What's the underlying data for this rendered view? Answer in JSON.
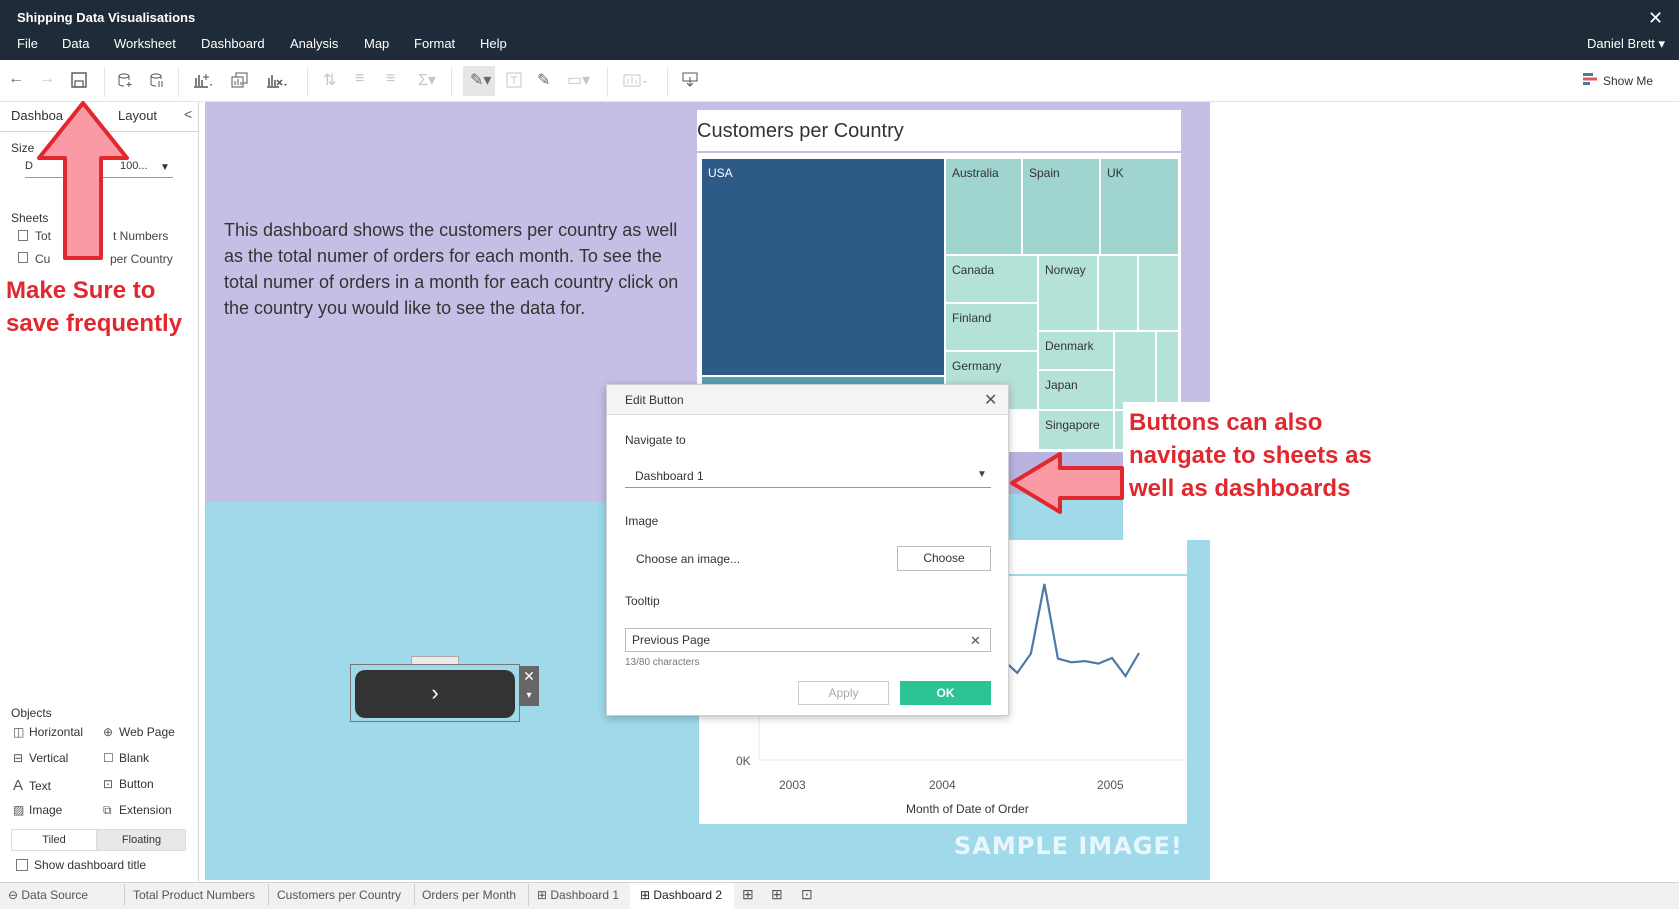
{
  "window": {
    "title": "Shipping Data Visualisations",
    "close_glyph": "✕"
  },
  "menu": {
    "items": [
      "File",
      "Data",
      "Worksheet",
      "Dashboard",
      "Analysis",
      "Map",
      "Format",
      "Help"
    ],
    "user": "Daniel Brett ▾"
  },
  "toolbar": {
    "show_me": "Show Me"
  },
  "left_pane": {
    "tab_dashboard": "Dashboa",
    "tab_layout": "Layout",
    "collapse": "<",
    "size_heading": "Size",
    "size_value_left": "D",
    "size_value_right": "100...",
    "size_caret": "▼",
    "sheets_heading": "Sheets",
    "sheet_1_left": "Tot",
    "sheet_1_right": "t Numbers",
    "sheet_2_left": "Cu",
    "sheet_2_right": "per Country",
    "objects_heading": "Objects",
    "objects": {
      "horizontal": "Horizontal",
      "web_page": "Web Page",
      "vertical": "Vertical",
      "blank": "Blank",
      "text": "Text",
      "button": "Button",
      "image": "Image",
      "extension": "Extension"
    },
    "tiled": "Tiled",
    "floating": "Floating",
    "show_dashboard_title": "Show dashboard title"
  },
  "dashboard": {
    "description": "This dashboard shows the customers per country as well as the total numer of orders for each month.  To see the total numer of orders in a month for each country click on the country you would like to see the data for.",
    "nav_button_glyph": "›",
    "watermark": "SAMPLE IMAGE!"
  },
  "treemap": {
    "title": "Customers per Country",
    "countries": [
      "USA",
      "Australia",
      "Spain",
      "UK",
      "Canada",
      "Norway",
      "Finland",
      "Denmark",
      "Germany",
      "Japan",
      "Singapore"
    ],
    "colors": {
      "dark": "#2e5a87",
      "mid": "#5a9fae",
      "light": "#9fd4cf",
      "lighter": "#b4e2d9"
    }
  },
  "chart_data": {
    "type": "line",
    "title": "",
    "xlabel": "Month of Date of Order",
    "ylabel": "",
    "x_ticks": [
      "2003",
      "2004",
      "2005"
    ],
    "y_ticks_visible": [
      "0K"
    ],
    "series": [
      {
        "values": [
          0.4,
          0.6,
          0.9,
          1.5,
          1.6,
          1.2,
          1.3,
          1.8,
          2.9,
          8.5,
          3.0,
          3.6,
          2.1,
          2.2,
          2.9,
          3.9,
          4.4,
          6.2,
          4.2,
          7.3,
          18.5,
          6.5,
          5.9,
          6.1,
          5.7,
          6.6,
          3.7,
          7.4
        ]
      }
    ],
    "line_color": "#4e79a7",
    "x_range": [
      "2003-01",
      "2005-05"
    ]
  },
  "floating_button": {
    "close": "✕",
    "more": "▾"
  },
  "dialog": {
    "title": "Edit Button",
    "close": "✕",
    "navigate_to_label": "Navigate to",
    "navigate_to_value": "Dashboard 1",
    "image_label": "Image",
    "image_placeholder": "Choose an image...",
    "choose": "Choose",
    "tooltip_label": "Tooltip",
    "tooltip_value": "Previous Page",
    "char_count": "13/80 characters",
    "apply": "Apply",
    "ok": "OK",
    "ok_color": "#2dc394"
  },
  "annotations": {
    "save": "Make Sure to save frequently",
    "navigate": "Buttons can also navigate to sheets as well as dashboards",
    "arrow_fill": "#f99aa4",
    "arrow_stroke": "#e0282e"
  },
  "bottom_tabs": {
    "data_source": "Data Source",
    "sheets": [
      "Total Product Numbers",
      "Customers per Country",
      "Orders per Month"
    ],
    "dashboard_1": "Dashboard 1",
    "dashboard_2": "Dashboard 2"
  }
}
